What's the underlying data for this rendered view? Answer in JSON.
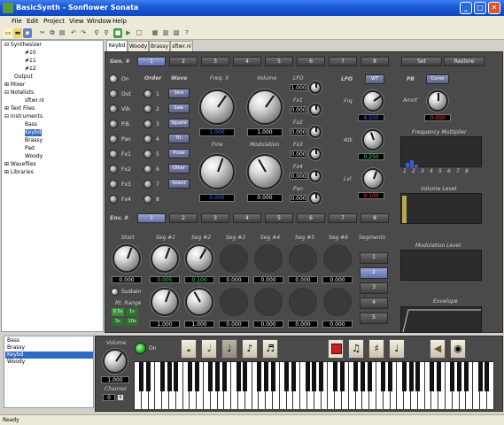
{
  "window": {
    "title": "BasicSynth - Sonflower Sonata",
    "minimize": "_",
    "maximize": "□",
    "close": "✕"
  },
  "menu": [
    "File",
    "Edit",
    "Project",
    "View",
    "Window",
    "Help"
  ],
  "toolbar_icons": [
    "new-icon",
    "open-icon",
    "save-icon",
    "cut-icon",
    "copy-icon",
    "paste-icon",
    "undo-icon",
    "redo-icon",
    "find-icon",
    "find-next-icon",
    "generate-icon",
    "play-icon",
    "stop-icon",
    "properties-icon",
    "mixer-icon",
    "info-icon"
  ],
  "tree": {
    "items": [
      {
        "label": "⊟ Synthesizer",
        "level": 0
      },
      {
        "label": "#10",
        "level": 2
      },
      {
        "label": "#11",
        "level": 2
      },
      {
        "label": "#12",
        "level": 2
      },
      {
        "label": "Output",
        "level": 1
      },
      {
        "label": "⊞ Mixer",
        "level": 0
      },
      {
        "label": "⊟ Notelists",
        "level": 0
      },
      {
        "label": "sftwr.nl",
        "level": 2
      },
      {
        "label": "⊞ Text Files",
        "level": 0
      },
      {
        "label": "⊟ Instruments",
        "level": 0
      },
      {
        "label": "Bass",
        "level": 2
      },
      {
        "label": "Keybd",
        "level": 2,
        "selected": true
      },
      {
        "label": "Brassy",
        "level": 2
      },
      {
        "label": "Pad",
        "level": 2
      },
      {
        "label": "Woody",
        "level": 2
      },
      {
        "label": "⊞ Wavefiles",
        "level": 0
      },
      {
        "label": "⊞ Libraries",
        "level": 0
      }
    ]
  },
  "tabs": [
    {
      "label": "Keybd",
      "active": true
    },
    {
      "label": "Woody",
      "active": false
    },
    {
      "label": "Brassy",
      "active": false
    },
    {
      "label": "sftwr.nl",
      "active": false
    }
  ],
  "gen": {
    "header": "Gen. #",
    "buttons": [
      "1",
      "2",
      "3",
      "4",
      "5",
      "6",
      "7",
      "8"
    ],
    "active": 0,
    "set_label": "Set",
    "restore_label": "Restore",
    "col_order": "Order",
    "col_wave": "Wave",
    "radios": [
      "On",
      "Out",
      "Vib.",
      "P.B.",
      "Pan",
      "Fx1",
      "Fx2",
      "Fx3",
      "Fx4"
    ],
    "order_radios": [
      "1",
      "2",
      "3",
      "4",
      "5",
      "6",
      "7",
      "8"
    ],
    "waves": [
      "Sine",
      "Saw.",
      "Square",
      "Tri.",
      "Pulse",
      "Other",
      "Select"
    ]
  },
  "knobs": {
    "freqx_label": "Freq. X",
    "freqx_value": "1.000",
    "volume_label": "Volume",
    "volume_value": "1.000",
    "fine_label": "Fine",
    "fine_value": "0.000",
    "modulation_label": "Modulation",
    "modulation_value": "0.000"
  },
  "lfo_values": {
    "labels": [
      "LFO",
      "Fx1",
      "Fx2",
      "Fx3",
      "Fx4",
      "Pan"
    ],
    "values": [
      "1.000",
      "0.000",
      "0.000",
      "0.000",
      "0.000",
      "0.000"
    ]
  },
  "lfo": {
    "header": "LFO",
    "wt_label": "WT",
    "frq_label": "Frq",
    "frq_value": "4.500",
    "atk_label": "Atk",
    "atk_value": "0.250",
    "lvl_label": "Lvl",
    "lvl_value": "0.100"
  },
  "pb": {
    "header": "PB",
    "curve_label": "Curve",
    "amnt_label": "Amnt",
    "amnt_value": "0.000"
  },
  "scopes": {
    "freq_mult": "Frequency Multiplier",
    "freq_mult_ticks": [
      "1",
      "2",
      "3",
      "4",
      "5",
      "6",
      "7",
      "8"
    ],
    "volume_level": "Volume Level",
    "modulation_level": "Modulation Level",
    "envelope": "Envelope"
  },
  "env": {
    "header": "Env. #",
    "buttons": [
      "1",
      "2",
      "3",
      "4",
      "5",
      "6",
      "7",
      "8"
    ],
    "active": 0,
    "seg_labels": [
      "Start",
      "Seg #1",
      "Seg #2",
      "Seg #3",
      "Seg #4",
      "Seg #5",
      "Seg #6"
    ],
    "row1_values": [
      "0.000",
      "0.005",
      "0.100",
      "0.000",
      "0.000",
      "0.000",
      "0.000"
    ],
    "row2_values": [
      "1.000",
      "1.000",
      "0.000",
      "0.000",
      "0.000",
      "0.000"
    ],
    "segments_label": "Segments",
    "segments": [
      "1",
      "2",
      "3",
      "4",
      "5"
    ],
    "segments_active": 1,
    "sustain_label": "Sustain",
    "rt_range_label": "Rt. Range",
    "rt_range_buttons": [
      "0.5s",
      "1s",
      "5s",
      "10s"
    ]
  },
  "patches": {
    "items": [
      "Bass",
      "Brassy",
      "Keybd",
      "Woody"
    ],
    "selected": 2
  },
  "inst": {
    "volume_label": "Volume",
    "volume_value": "1.000",
    "channel_label": "Channel",
    "channel_value": "0",
    "on_label": "On",
    "notes": [
      "𝅝",
      "𝅗𝅥",
      "♩",
      "♪",
      "♬"
    ],
    "note_names": [
      "whole-note-icon",
      "half-note-icon",
      "quarter-note-icon",
      "eighth-note-icon",
      "sixteenth-note-icon"
    ],
    "active_note": 2
  },
  "status": {
    "text": "Ready"
  },
  "colors": {
    "panel": "#4a4a4a",
    "accent_blue": "#316ac5",
    "value_blue": "#4f6bff",
    "value_red": "#ff3b3b",
    "value_green": "#45e06a"
  }
}
